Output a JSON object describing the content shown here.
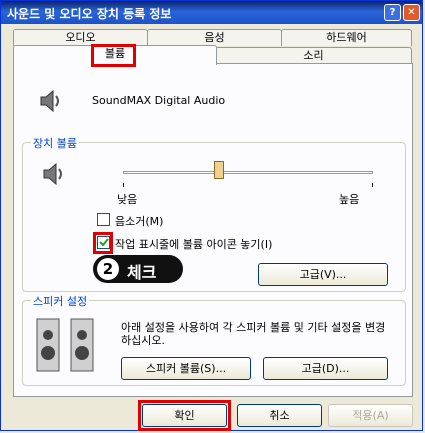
{
  "window": {
    "title": "사운드 및 오디오 장치 등록 정보",
    "help_glyph": "?",
    "close_glyph": "✕"
  },
  "tabs": {
    "row1": [
      "오디오",
      "음성",
      "하드웨어"
    ],
    "row2": [
      "볼륨",
      "소리"
    ],
    "active": "볼륨"
  },
  "device": {
    "name": "SoundMAX Digital Audio"
  },
  "device_volume": {
    "group_label": "장치 볼륨",
    "slider_min_label": "낮음",
    "slider_max_label": "높음",
    "slider_level": 0.38,
    "mute_label": "음소거(M)",
    "mute_checked": false,
    "tray_icon_label": "작업 표시줄에 볼륨 아이콘 놓기(I)",
    "tray_icon_checked": true,
    "advanced_button": "고급(V)..."
  },
  "annotation": {
    "number": "2",
    "text": "체크",
    "color": "#e00000"
  },
  "speaker_settings": {
    "group_label": "스피커 설정",
    "description": "아래 설정을 사용하여 각 스피커 볼륨 및 기타 설정을 변경하십시오.",
    "speaker_volume_button": "스피커 볼륨(S)...",
    "advanced_button": "고급(D)..."
  },
  "footer": {
    "ok": "확인",
    "cancel": "취소",
    "apply": "적용(A)"
  }
}
